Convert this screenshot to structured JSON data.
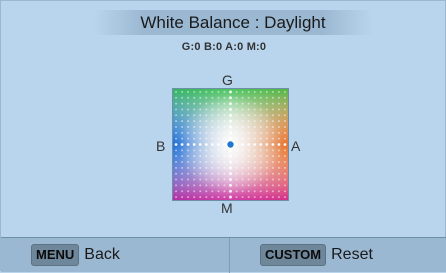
{
  "title": "White Balance : Daylight",
  "readout": "G:0 B:0 A:0 M:0",
  "axis_labels": {
    "top": "G",
    "left": "B",
    "right": "A",
    "bottom": "M"
  },
  "cursor": {
    "g_m": 0,
    "b_a": 0,
    "color": "#1e78d2"
  },
  "softkeys": [
    {
      "key": "MENU",
      "label": "Back"
    },
    {
      "key": "CUSTOM",
      "label": "Reset"
    }
  ],
  "colors": {
    "background": "#b9d5ee",
    "bar": "#9bb8d2",
    "key_badge": "#6f879b"
  }
}
